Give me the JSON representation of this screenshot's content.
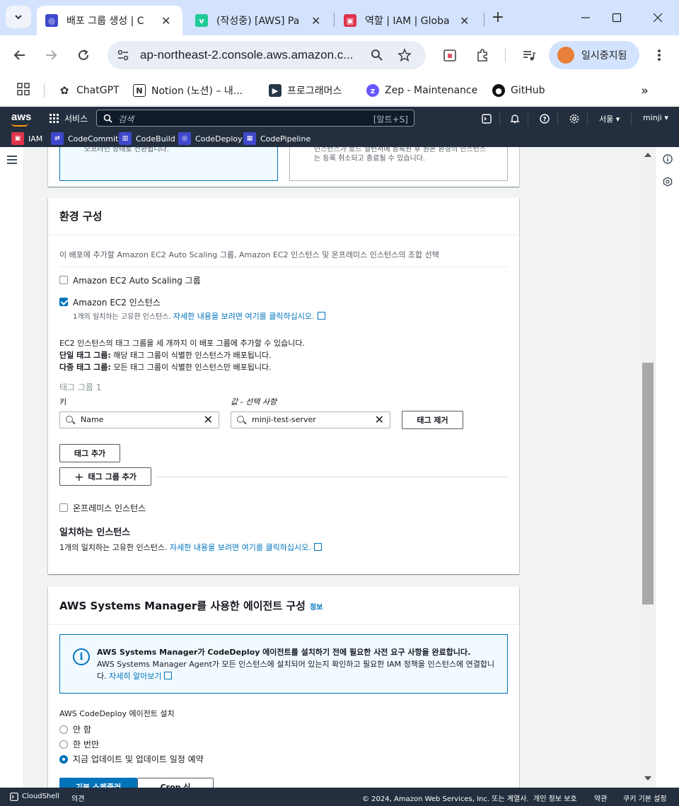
{
  "browser": {
    "tabs": [
      {
        "label": "배포 그룹 생성 | C",
        "active": true,
        "color": "#3f48cc",
        "icon": "codedeploy-icon"
      },
      {
        "label": "(작성중) [AWS] Pa",
        "active": false,
        "color": "#20c997",
        "icon": "velog-icon"
      },
      {
        "label": "역할 | IAM | Globa",
        "active": false,
        "color": "#dd344c",
        "icon": "iam-icon"
      }
    ],
    "url": "ap-northeast-2.console.aws.amazon.c...",
    "profile_label": "일시중지됨",
    "bookmarks": [
      "ChatGPT",
      "Notion (노션) – 내...",
      "프로그래머스",
      "Zep - Maintenance",
      "GitHub"
    ]
  },
  "aws_nav": {
    "logo": "aws",
    "services_label": "서비스",
    "search_placeholder": "검색",
    "search_shortcut": "[알트+S]",
    "region": "서울 ▾",
    "user": "minji ▾",
    "favorites": [
      {
        "label": "IAM",
        "color": "#dd344c"
      },
      {
        "label": "CodeCommit",
        "color": "#3f48cc"
      },
      {
        "label": "CodeBuild",
        "color": "#3f48cc"
      },
      {
        "label": "CodeDeploy",
        "color": "#3f48cc"
      },
      {
        "label": "CodePipeline",
        "color": "#3f48cc"
      }
    ]
  },
  "top_tiles": {
    "left_text": "오프라인 상태로 전환됩니다.",
    "right_text_1": "인스턴스가 로드 밸런서에 등록된 후 원본 환경의 인스턴스",
    "right_text_2": "는 등록 취소되고 종료될 수 있습니다."
  },
  "env_config": {
    "title": "환경 구성",
    "description": "이 배포에 추가할 Amazon EC2 Auto Scaling 그룹, Amazon EC2 인스턴스 및 온프레미스 인스턴스의 조합 선택",
    "asg_label": "Amazon EC2 Auto Scaling 그룹",
    "asg_checked": false,
    "ec2_label": "Amazon EC2 인스턴스",
    "ec2_checked": true,
    "ec2_sub_prefix": "1개의 일치하는 고유한 인스턴스.",
    "ec2_sub_link": "자세한 내용을 보려면 여기를 클릭하십시오.",
    "tag_info_line1": "EC2 인스턴스의 태그 그룹을 세 개까지 이 배포 그룹에 추가할 수 있습니다.",
    "tag_info_single_bold": "단일 태그 그룹:",
    "tag_info_single_rest": " 해당 태그 그룹이 식별한 인스턴스가 배포됩니다.",
    "tag_info_multi_bold": "다중 태그 그룹:",
    "tag_info_multi_rest": " 모든 태그 그룹이 식별한 인스턴스만 배포됩니다.",
    "tag_group_title": "태그 그룹 1",
    "key_label": "키",
    "value_label": "값 - 선택 사항",
    "key_value": "Name",
    "value_value": "minji-test-server",
    "remove_tag_button": "태그 제거",
    "add_tag_button": "태그 추가",
    "add_tag_group_button": "태그 그룹 추가",
    "onprem_label": "온프레미스 인스턴스",
    "onprem_checked": false,
    "matching_title": "일치하는 인스턴스",
    "matching_prefix": "1개의 일치하는 고유한 인스턴스.",
    "matching_link": "자세한 내용을 보려면 여기를 클릭하십시오."
  },
  "ssm": {
    "title": "AWS Systems Manager를 사용한 에이전트 구성",
    "info_link": "정보",
    "alert_title": "AWS Systems Manager가 CodeDeploy 에이전트를 설치하기 전에 필요한 사전 요구 사항을 완료합니다.",
    "alert_body": "AWS Systems Manager Agent가 모든 인스턴스에 설치되어 있는지 확인하고 필요한 IAM 정책을 인스턴스에 연결합니다.",
    "alert_link": "자세히 알아보기",
    "install_label": "AWS CodeDeploy 에이전트 설치",
    "options": [
      "안 함",
      "한 번만",
      "지금 업데이트 및 업데이트 일정 예약"
    ],
    "selected_option": 2,
    "schedule_tabs": [
      "기본 스케줄러",
      "Cron 식"
    ]
  },
  "footer": {
    "cloudshell": "CloudShell",
    "feedback": "의견",
    "copyright": "© 2024, Amazon Web Services, Inc. 또는 계열사.",
    "privacy": "개인 정보 보호",
    "terms": "약관",
    "cookies": "쿠키 기본 설정"
  }
}
